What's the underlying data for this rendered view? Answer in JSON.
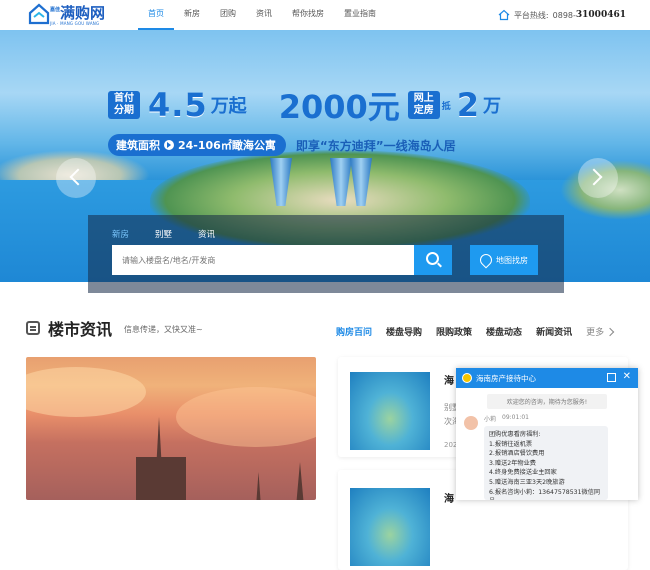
{
  "header": {
    "logo": {
      "name": "满购网",
      "sub": "嘉佳",
      "pinyin": "JIA · MANG GOU WANG"
    },
    "nav": [
      "首页",
      "新房",
      "团购",
      "资讯",
      "帮你找房",
      "置业指南"
    ],
    "hotline_label": "平台热线:",
    "hotline_prefix": "0898-",
    "hotline_number": "31000461"
  },
  "banner": {
    "tag1": "首付分期",
    "amount1": "4.5",
    "unit1": "万起",
    "amount2": "2000元",
    "tag2": "网上定房",
    "di": "抵",
    "amount3": "2",
    "unit3": "万",
    "pill_left": "建筑面积",
    "pill_right": "24-106㎡瞰海公寓",
    "tagline": "即享“东方迪拜”一线海岛人居"
  },
  "search": {
    "tabs": [
      "新房",
      "别墅",
      "资讯"
    ],
    "active_tab": "新房",
    "placeholder": "请输入楼盘名/地名/开发商",
    "map_button": "地图找房"
  },
  "news": {
    "title": "楼市资讯",
    "subtitle": "信息传递，又快又准~",
    "tabs": [
      "购房百问",
      "楼盘导购",
      "限购政策",
      "楼盘动态",
      "新闻资讯"
    ],
    "more": "更多",
    "articles": [
      {
        "title": "海",
        "text1": "别墅",
        "text2": "次海",
        "date": "2020"
      },
      {
        "title": "海"
      }
    ]
  },
  "chat": {
    "title": "海南房产接待中心",
    "greeting": "欢迎您的咨询，期待为您服务!",
    "agent": "小莉",
    "time": "09:01:01",
    "lines": [
      "团购优惠看房福利:",
      "1.报销往返机票",
      "2.报销酒店餐饮费用",
      "3.赠送2年物业费",
      "4.终身免费接送业主回家",
      "5.赠送海南三亚3天2晚旅游",
      "6.报名咨询小莉：13647578531微信同号"
    ]
  }
}
